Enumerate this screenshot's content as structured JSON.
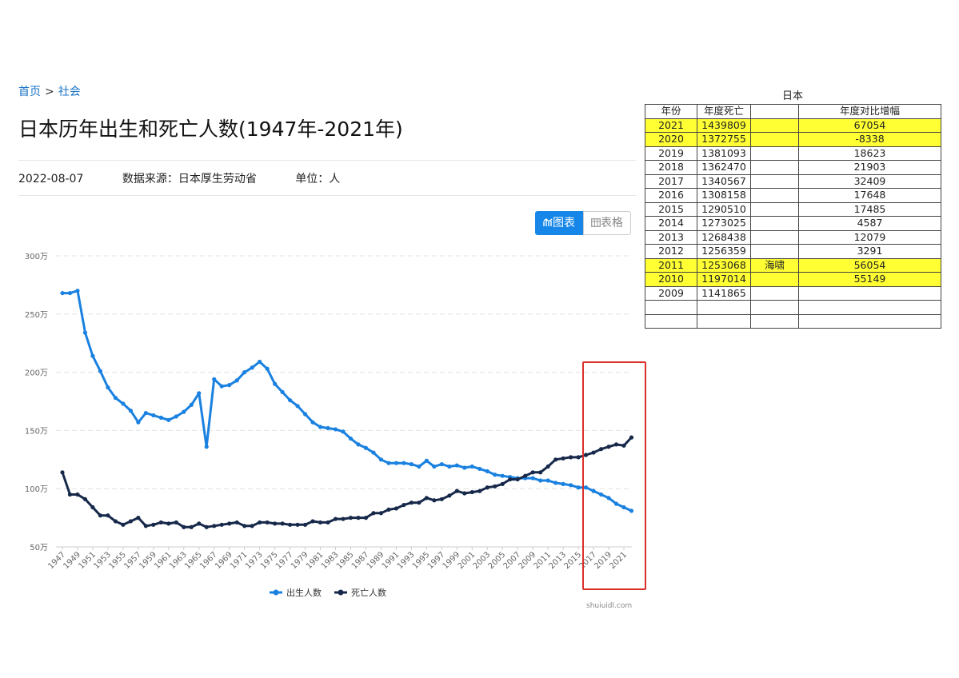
{
  "breadcrumb": {
    "home": "首页",
    "separator": ">",
    "section": "社会"
  },
  "title": "日本历年出生和死亡人数(1947年-2021年)",
  "meta": {
    "date": "2022-08-07",
    "source": "数据来源：日本厚生劳动省",
    "unit": "单位：人"
  },
  "view_toggle": {
    "chart_label": "图表",
    "table_label": "表格",
    "chart_icon": "chart-icon",
    "table_icon": "table-icon"
  },
  "watermark": "shuiuidl.com",
  "colors": {
    "births": "#1a81e0",
    "deaths": "#17294a",
    "accent": "#1687e8",
    "highlight": "#ffff33",
    "box": "#d9302a"
  },
  "chart_data": {
    "type": "line",
    "title": "",
    "xlabel": "",
    "ylabel": "",
    "y_ticks": [
      "300万",
      "250万",
      "200万",
      "150万",
      "100万",
      "50万"
    ],
    "y_tick_values": [
      300,
      250,
      200,
      150,
      100,
      50
    ],
    "ylim": [
      50,
      300
    ],
    "y_unit": "万",
    "x_start": 1947,
    "x_end": 2021,
    "x_tick_labels": [
      "1947",
      "1949",
      "1951",
      "1953",
      "1955",
      "1957",
      "1959",
      "1961",
      "1963",
      "1965",
      "1967",
      "1969",
      "1971",
      "1973",
      "1975",
      "1977",
      "1979",
      "1981",
      "1983",
      "1985",
      "1987",
      "1989",
      "1991",
      "1993",
      "1995",
      "1997",
      "1999",
      "2001",
      "2003",
      "2005",
      "2007",
      "2009",
      "2011",
      "2013",
      "2015",
      "2017",
      "2019",
      "2021"
    ],
    "legend_position": "bottom",
    "grid": true,
    "series": [
      {
        "name": "出生人数",
        "values": [
          268,
          268,
          270,
          234,
          214,
          201,
          187,
          178,
          173,
          167,
          157,
          165,
          163,
          161,
          159,
          162,
          166,
          172,
          182,
          136,
          194,
          188,
          189,
          193,
          200,
          204,
          209,
          203,
          190,
          183,
          176,
          171,
          164,
          157,
          153,
          152,
          151,
          149,
          143,
          138,
          135,
          131,
          125,
          122,
          122,
          122,
          121,
          119,
          124,
          119,
          121,
          119,
          120,
          118,
          119,
          117,
          115,
          112,
          111,
          110,
          109,
          109,
          109,
          107,
          107,
          105,
          104,
          103,
          101,
          101,
          98,
          95,
          92,
          87,
          84,
          81
        ]
      },
      {
        "name": "死亡人数",
        "values": [
          114,
          95,
          95,
          91,
          84,
          77,
          77,
          72,
          69,
          72,
          75,
          68,
          69,
          71,
          70,
          71,
          67,
          67,
          70,
          67,
          68,
          69,
          70,
          71,
          68,
          68,
          71,
          71,
          70,
          70,
          69,
          69,
          69,
          72,
          71,
          71,
          74,
          74,
          75,
          75,
          75,
          79,
          79,
          82,
          83,
          86,
          88,
          88,
          92,
          90,
          91,
          94,
          98,
          96,
          97,
          98,
          101,
          102,
          104,
          108,
          108,
          111,
          114,
          114,
          119,
          125,
          126,
          127,
          127,
          129,
          131,
          134,
          136,
          138,
          137,
          144
        ]
      }
    ]
  },
  "table": {
    "caption": "日本",
    "headers": [
      "年份",
      "年度死亡",
      "",
      "年度对比增幅"
    ],
    "rows": [
      {
        "year": "2021",
        "deaths": "1439809",
        "note": "",
        "change": "67054",
        "highlight": true
      },
      {
        "year": "2020",
        "deaths": "1372755",
        "note": "",
        "change": "-8338",
        "highlight": true
      },
      {
        "year": "2019",
        "deaths": "1381093",
        "note": "",
        "change": "18623",
        "highlight": false
      },
      {
        "year": "2018",
        "deaths": "1362470",
        "note": "",
        "change": "21903",
        "highlight": false
      },
      {
        "year": "2017",
        "deaths": "1340567",
        "note": "",
        "change": "32409",
        "highlight": false
      },
      {
        "year": "2016",
        "deaths": "1308158",
        "note": "",
        "change": "17648",
        "highlight": false
      },
      {
        "year": "2015",
        "deaths": "1290510",
        "note": "",
        "change": "17485",
        "highlight": false
      },
      {
        "year": "2014",
        "deaths": "1273025",
        "note": "",
        "change": "4587",
        "highlight": false
      },
      {
        "year": "2013",
        "deaths": "1268438",
        "note": "",
        "change": "12079",
        "highlight": false
      },
      {
        "year": "2012",
        "deaths": "1256359",
        "note": "",
        "change": "3291",
        "highlight": false
      },
      {
        "year": "2011",
        "deaths": "1253068",
        "note": "海啸",
        "change": "56054",
        "highlight": true
      },
      {
        "year": "2010",
        "deaths": "1197014",
        "note": "",
        "change": "55149",
        "highlight": true
      },
      {
        "year": "2009",
        "deaths": "1141865",
        "note": "",
        "change": "",
        "highlight": false
      },
      {
        "year": "",
        "deaths": "",
        "note": "",
        "change": "",
        "highlight": false
      },
      {
        "year": "",
        "deaths": "",
        "note": "",
        "change": "",
        "highlight": false
      }
    ]
  }
}
